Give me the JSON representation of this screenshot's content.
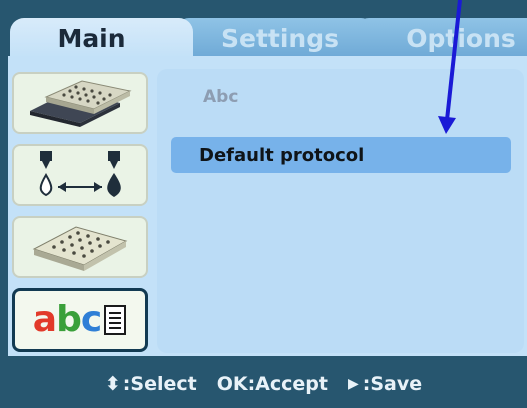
{
  "tabs": [
    {
      "label": "Main",
      "active": true
    },
    {
      "label": "Settings",
      "active": false
    },
    {
      "label": "Options",
      "active": false
    }
  ],
  "sidebar": {
    "items": [
      {
        "name": "plates",
        "icon": "microplate-stack-icon",
        "selected": false
      },
      {
        "name": "dispense",
        "icon": "dispenser-arrows-icon",
        "selected": false
      },
      {
        "name": "plate",
        "icon": "microplate-icon",
        "selected": false
      },
      {
        "name": "protocols",
        "icon": "abc-list-icon",
        "text": "abc",
        "selected": true
      }
    ]
  },
  "content": {
    "category_label": "Abc",
    "items": [
      "Default protocol"
    ],
    "selected_index": 0
  },
  "footer": {
    "select": {
      "glyph": "⬍",
      "label": ":Select"
    },
    "accept": {
      "label": "OK:Accept"
    },
    "save": {
      "glyph": "▶",
      "label": ":Save"
    }
  },
  "colors": {
    "frame": "#27566f",
    "panel": "#c3e1f8",
    "highlight": "#77b2ea",
    "annotation_arrow": "#1a1ad6"
  }
}
